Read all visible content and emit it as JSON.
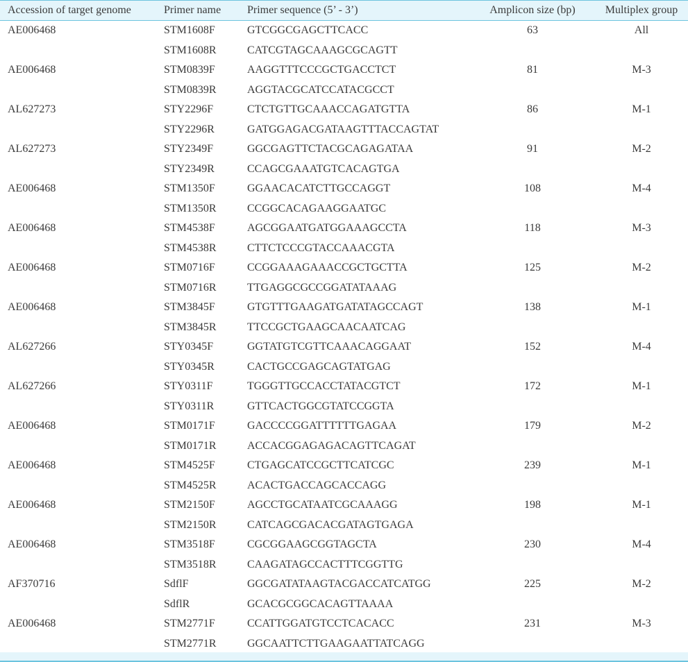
{
  "headers": {
    "accession": "Accession of target genome",
    "primer_name": "Primer name",
    "primer_sequence": "Primer sequence (5’ - 3’)",
    "amplicon_size": "Amplicon size (bp)",
    "multiplex_group": "Multiplex group"
  },
  "rows": [
    {
      "accession": "AE006468",
      "primer_name": "STM1608F",
      "sequence": "GTCGGCGAGCTTCACC",
      "amplicon": "63",
      "group": "All"
    },
    {
      "accession": "",
      "primer_name": "STM1608R",
      "sequence": "CATCGTAGCAAAGCGCAGTT",
      "amplicon": "",
      "group": ""
    },
    {
      "accession": "AE006468",
      "primer_name": "STM0839F",
      "sequence": "AAGGTTTCCCGCTGACCTCT",
      "amplicon": "81",
      "group": "M-3"
    },
    {
      "accession": "",
      "primer_name": "STM0839R",
      "sequence": "AGGTACGCATCCATACGCCT",
      "amplicon": "",
      "group": ""
    },
    {
      "accession": "AL627273",
      "primer_name": "STY2296F",
      "sequence": "CTCTGTTGCAAACCAGATGTTA",
      "amplicon": "86",
      "group": "M-1"
    },
    {
      "accession": "",
      "primer_name": "STY2296R",
      "sequence": "GATGGAGACGATAAGTTTACCAGTAT",
      "amplicon": "",
      "group": ""
    },
    {
      "accession": "AL627273",
      "primer_name": "STY2349F",
      "sequence": "GGCGAGTTCTACGCAGAGATAA",
      "amplicon": "91",
      "group": "M-2"
    },
    {
      "accession": "",
      "primer_name": "STY2349R",
      "sequence": "CCAGCGAAATGTCACAGTGA",
      "amplicon": "",
      "group": ""
    },
    {
      "accession": "AE006468",
      "primer_name": "STM1350F",
      "sequence": "GGAACACATCTTGCCAGGT",
      "amplicon": "108",
      "group": "M-4"
    },
    {
      "accession": "",
      "primer_name": "STM1350R",
      "sequence": "CCGGCACAGAAGGAATGC",
      "amplicon": "",
      "group": ""
    },
    {
      "accession": "AE006468",
      "primer_name": "STM4538F",
      "sequence": "AGCGGAATGATGGAAAGCCTA",
      "amplicon": "118",
      "group": "M-3"
    },
    {
      "accession": "",
      "primer_name": "STM4538R",
      "sequence": "CTTCTCCCGTACCAAACGTA",
      "amplicon": "",
      "group": ""
    },
    {
      "accession": "AE006468",
      "primer_name": "STM0716F",
      "sequence": "CCGGAAAGAAACCGCTGCTTA",
      "amplicon": "125",
      "group": "M-2"
    },
    {
      "accession": "",
      "primer_name": "STM0716R",
      "sequence": "TTGAGGCGCCGGATATAAAG",
      "amplicon": "",
      "group": ""
    },
    {
      "accession": "AE006468",
      "primer_name": "STM3845F",
      "sequence": "GTGTTTGAAGATGATATAGCCAGT",
      "amplicon": "138",
      "group": "M-1"
    },
    {
      "accession": "",
      "primer_name": "STM3845R",
      "sequence": "TTCCGCTGAAGCAACAATCAG",
      "amplicon": "",
      "group": ""
    },
    {
      "accession": "AL627266",
      "primer_name": "STY0345F",
      "sequence": "GGTATGTCGTTCAAACAGGAAT",
      "amplicon": "152",
      "group": "M-4"
    },
    {
      "accession": "",
      "primer_name": "STY0345R",
      "sequence": "CACTGCCGAGCAGTATGAG",
      "amplicon": "",
      "group": ""
    },
    {
      "accession": "AL627266",
      "primer_name": "STY0311F",
      "sequence": "TGGGTTGCCACCTATACGTCT",
      "amplicon": "172",
      "group": "M-1"
    },
    {
      "accession": "",
      "primer_name": "STY0311R",
      "sequence": "GTTCACTGGCGTATCCGGTA",
      "amplicon": "",
      "group": ""
    },
    {
      "accession": "AE006468",
      "primer_name": "STM0171F",
      "sequence": "GACCCCGGATTTTTTGAGAA",
      "amplicon": "179",
      "group": "M-2"
    },
    {
      "accession": "",
      "primer_name": "STM0171R",
      "sequence": "ACCACGGAGAGACAGTTCAGAT",
      "amplicon": "",
      "group": ""
    },
    {
      "accession": "AE006468",
      "primer_name": "STM4525F",
      "sequence": "CTGAGCATCCGCTTCATCGC",
      "amplicon": "239",
      "group": "M-1"
    },
    {
      "accession": "",
      "primer_name": "STM4525R",
      "sequence": "ACACTGACCAGCACCAGG",
      "amplicon": "",
      "group": ""
    },
    {
      "accession": "AE006468",
      "primer_name": "STM2150F",
      "sequence": "AGCCTGCATAATCGCAAAGG",
      "amplicon": "198",
      "group": "M-1"
    },
    {
      "accession": "",
      "primer_name": "STM2150R",
      "sequence": "CATCAGCGACACGATAGTGAGA",
      "amplicon": "",
      "group": ""
    },
    {
      "accession": "AE006468",
      "primer_name": "STM3518F",
      "sequence": "CGCGGAAGCGGTAGCTA",
      "amplicon": "230",
      "group": "M-4"
    },
    {
      "accession": "",
      "primer_name": "STM3518R",
      "sequence": "CAAGATAGCCACTTTCGGTTG",
      "amplicon": "",
      "group": ""
    },
    {
      "accession": "AF370716",
      "primer_name": "SdflF",
      "sequence": "GGCGATATAAGTACGACCATCATGG",
      "amplicon": "225",
      "group": "M-2"
    },
    {
      "accession": "",
      "primer_name": "SdflR",
      "sequence": "GCACGCGGCACAGTTAAAA",
      "amplicon": "",
      "group": ""
    },
    {
      "accession": "AE006468",
      "primer_name": "STM2771F",
      "sequence": "CCATTGGATGTCCTCACACC",
      "amplicon": "231",
      "group": "M-3"
    },
    {
      "accession": "",
      "primer_name": "STM2771R",
      "sequence": "GGCAATTCTTGAAGAATTATCAGG",
      "amplicon": "",
      "group": ""
    }
  ]
}
